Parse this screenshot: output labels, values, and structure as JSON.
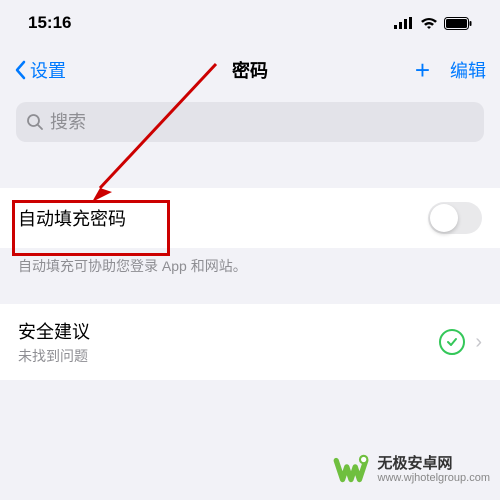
{
  "status": {
    "time": "15:16"
  },
  "nav": {
    "back": "设置",
    "title": "密码",
    "edit": "编辑",
    "plus": "+"
  },
  "search": {
    "placeholder": "搜索"
  },
  "autofill": {
    "label": "自动填充密码",
    "note": "自动填充可协助您登录 App 和网站。"
  },
  "security": {
    "label": "安全建议",
    "sub": "未找到问题"
  },
  "watermark": {
    "title": "无极安卓网",
    "url": "www.wjhotelgroup.com"
  }
}
